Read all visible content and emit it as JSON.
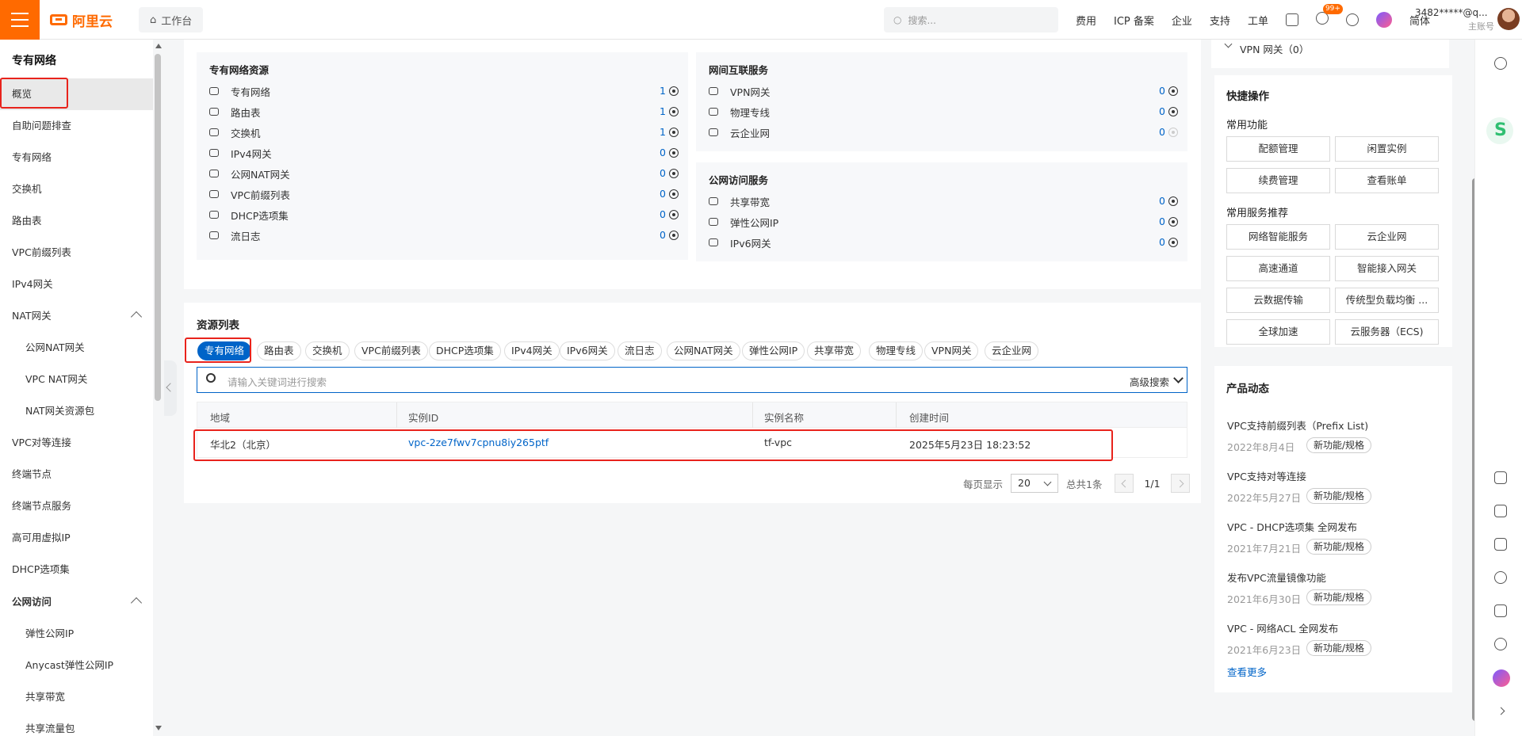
{
  "topbar": {
    "logo": "阿里云",
    "workbench": "工作台",
    "search_placeholder": "搜索...",
    "nav": [
      "费用",
      "ICP 备案",
      "企业",
      "支持",
      "工单"
    ],
    "badge": "99+",
    "lang": "简体",
    "account": "3482*****@q...",
    "account_type": "主账号"
  },
  "sidebar": {
    "title": "专有网络",
    "items": [
      {
        "label": "概览",
        "sub": false,
        "active": true
      },
      {
        "label": "自助问题排查",
        "sub": false
      },
      {
        "label": "专有网络",
        "sub": false
      },
      {
        "label": "交换机",
        "sub": false
      },
      {
        "label": "路由表",
        "sub": false
      },
      {
        "label": "VPC前缀列表",
        "sub": false
      },
      {
        "label": "IPv4网关",
        "sub": false
      },
      {
        "label": "NAT网关",
        "sub": false,
        "expanded": true
      },
      {
        "label": "公网NAT网关",
        "sub": true
      },
      {
        "label": "VPC NAT网关",
        "sub": true
      },
      {
        "label": "NAT网关资源包",
        "sub": true
      },
      {
        "label": "VPC对等连接",
        "sub": false
      },
      {
        "label": "终端节点",
        "sub": false
      },
      {
        "label": "终端节点服务",
        "sub": false
      },
      {
        "label": "高可用虚拟IP",
        "sub": false
      },
      {
        "label": "DHCP选项集",
        "sub": false
      },
      {
        "label": "公网访问",
        "sub": false,
        "expanded": true,
        "bold": true
      },
      {
        "label": "弹性公网IP",
        "sub": true
      },
      {
        "label": "Anycast弹性公网IP",
        "sub": true
      },
      {
        "label": "共享带宽",
        "sub": true
      },
      {
        "label": "共享流量包",
        "sub": true
      }
    ]
  },
  "overview": {
    "vpn_top": "VPN 网关（0）",
    "vpc_resources": {
      "title": "专有网络资源",
      "rows": [
        {
          "label": "专有网络",
          "count": "1"
        },
        {
          "label": "路由表",
          "count": "1"
        },
        {
          "label": "交换机",
          "count": "1"
        },
        {
          "label": "IPv4网关",
          "count": "0"
        },
        {
          "label": "公网NAT网关",
          "count": "0"
        },
        {
          "label": "VPC前缀列表",
          "count": "0"
        },
        {
          "label": "DHCP选项集",
          "count": "0"
        },
        {
          "label": "流日志",
          "count": "0"
        }
      ]
    },
    "interconnect": {
      "title": "网间互联服务",
      "rows": [
        {
          "label": "VPN网关",
          "count": "0"
        },
        {
          "label": "物理专线",
          "count": "0"
        },
        {
          "label": "云企业网",
          "count": "0"
        }
      ]
    },
    "public_access": {
      "title": "公网访问服务",
      "rows": [
        {
          "label": "共享带宽",
          "count": "0"
        },
        {
          "label": "弹性公网IP",
          "count": "0"
        },
        {
          "label": "IPv6网关",
          "count": "0"
        }
      ]
    }
  },
  "resource_list": {
    "title": "资源列表",
    "tabs": [
      "专有网络",
      "路由表",
      "交换机",
      "VPC前缀列表",
      "DHCP选项集",
      "IPv4网关",
      "IPv6网关",
      "流日志",
      "公网NAT网关",
      "弹性公网IP",
      "共享带宽",
      "物理专线",
      "VPN网关",
      "云企业网"
    ],
    "search_placeholder": "请输入关键词进行搜索",
    "advanced_search": "高级搜索",
    "columns": [
      "地域",
      "实例ID",
      "实例名称",
      "创建时间"
    ],
    "rows": [
      {
        "region": "华北2（北京）",
        "id": "vpc-2ze7fwv7cpnu8iy265ptf",
        "name": "tf-vpc",
        "created": "2025年5月23日 18:23:52"
      }
    ],
    "pager": {
      "per_page_label": "每页显示",
      "per_page": "20",
      "total": "总共1条",
      "page": "1/1"
    }
  },
  "quick_ops": {
    "title": "快捷操作",
    "common_label": "常用功能",
    "common": [
      "配额管理",
      "闲置实例",
      "续费管理",
      "查看账单"
    ],
    "recommend_label": "常用服务推荐",
    "recommend": [
      "网络智能服务",
      "云企业网",
      "高速通道",
      "智能接入网关",
      "云数据传输",
      "传统型负载均衡 ...",
      "全球加速",
      "云服务器（ECS)"
    ]
  },
  "news": {
    "title": "产品动态",
    "items": [
      {
        "title": "VPC支持前缀列表（Prefix List)",
        "date": "2022年8月4日",
        "tag": "新功能/规格"
      },
      {
        "title": "VPC支持对等连接",
        "date": "2022年5月27日",
        "tag": "新功能/规格"
      },
      {
        "title": "VPC - DHCP选项集 全网发布",
        "date": "2021年7月21日",
        "tag": "新功能/规格"
      },
      {
        "title": "发布VPC流量镜像功能",
        "date": "2021年6月30日",
        "tag": "新功能/规格"
      },
      {
        "title": "VPC - 网络ACL 全网发布",
        "date": "2021年6月23日",
        "tag": "新功能/规格"
      }
    ],
    "more": "查看更多"
  },
  "colors": {
    "brand": "#ff6a00",
    "link": "#0064c8",
    "highlight": "#e8231c"
  }
}
